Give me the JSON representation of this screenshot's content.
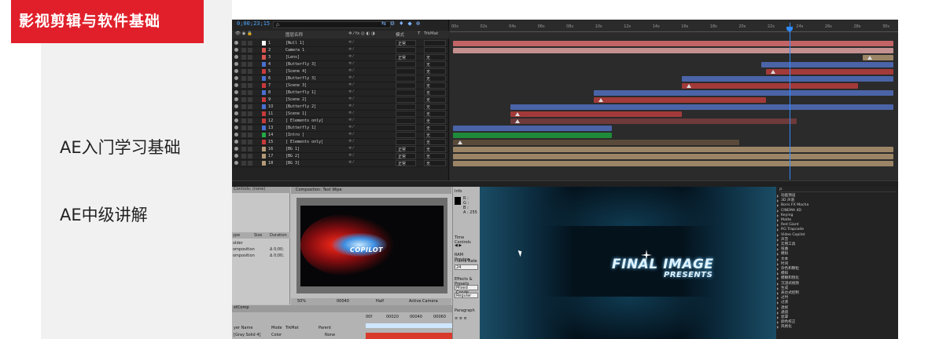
{
  "course": {
    "badge": "影视剪辑与软件基础",
    "lessons": [
      "AE入门学习基础",
      "AE中级讲解"
    ]
  },
  "timeline": {
    "timecode": "0;00;23;15",
    "search_placeholder": "ρ.",
    "columns": {
      "name": "图层名称",
      "mode": "模式",
      "t": "T",
      "trkmat": "TrkMat"
    },
    "layers": [
      {
        "num": "1",
        "name": "[Null 1]",
        "color": "#ffffff",
        "mode": "正常",
        "trk": ""
      },
      {
        "num": "2",
        "name": "Camera 1",
        "color": "#d9534f",
        "mode": "",
        "trk": ""
      },
      {
        "num": "3",
        "name": "[Lens]",
        "color": "#d9534f",
        "mode": "正常",
        "trk": "无"
      },
      {
        "num": "4",
        "name": "[Butterfly 3]",
        "color": "#4a6fd0",
        "mode": "",
        "trk": "无"
      },
      {
        "num": "5",
        "name": "[Scene 4]",
        "color": "#c83a3a",
        "mode": "",
        "trk": "无"
      },
      {
        "num": "6",
        "name": "[Butterfly 3]",
        "color": "#4a6fd0",
        "mode": "",
        "trk": "无"
      },
      {
        "num": "7",
        "name": "[Scene 3]",
        "color": "#c83a3a",
        "mode": "",
        "trk": "无"
      },
      {
        "num": "8",
        "name": "[Butterfly 1]",
        "color": "#4a6fd0",
        "mode": "",
        "trk": "无"
      },
      {
        "num": "9",
        "name": "[Scene 2]",
        "color": "#c83a3a",
        "mode": "",
        "trk": "无"
      },
      {
        "num": "10",
        "name": "[Butterfly 2]",
        "color": "#4a6fd0",
        "mode": "",
        "trk": "无"
      },
      {
        "num": "11",
        "name": "[Scene 1]",
        "color": "#c83a3a",
        "mode": "",
        "trk": "无"
      },
      {
        "num": "12",
        "name": "[ Elements only]",
        "color": "#c83a3a",
        "mode": "",
        "trk": "无"
      },
      {
        "num": "13",
        "name": "[Butterfly 1]",
        "color": "#4a6fd0",
        "mode": "",
        "trk": "无"
      },
      {
        "num": "14",
        "name": "[Intro ]",
        "color": "#22aa44",
        "mode": "",
        "trk": "无"
      },
      {
        "num": "15",
        "name": "[ Elements only]",
        "color": "#c83a3a",
        "mode": "",
        "trk": "无"
      },
      {
        "num": "16",
        "name": "[BG 1]",
        "color": "#b59a78",
        "mode": "正常",
        "trk": "无"
      },
      {
        "num": "17",
        "name": "[BG 2]",
        "color": "#b59a78",
        "mode": "正常",
        "trk": "无"
      },
      {
        "num": "18",
        "name": "[BG 3]",
        "color": "#b59a78",
        "mode": "正常",
        "trk": "无"
      }
    ],
    "ruler_ticks": [
      "00s",
      "02s",
      "04s",
      "06s",
      "08s",
      "10s",
      "12s",
      "14s",
      "16s",
      "18s",
      "20s",
      "22s",
      "24s",
      "26s",
      "28s",
      "30s"
    ],
    "bars": [
      {
        "start": 0.0,
        "end": 1.0,
        "color": "#c26466"
      },
      {
        "start": 0.0,
        "end": 1.0,
        "color": "#c49090"
      },
      {
        "start": 0.93,
        "end": 1.0,
        "color": "#9c8566",
        "key": true
      },
      {
        "start": 0.7,
        "end": 1.0,
        "color": "#4b64a8"
      },
      {
        "start": 0.71,
        "end": 1.0,
        "color": "#a33a3a",
        "key": true
      },
      {
        "start": 0.52,
        "end": 1.0,
        "color": "#4b64a8"
      },
      {
        "start": 0.52,
        "end": 0.92,
        "color": "#a33a3a",
        "key": true
      },
      {
        "start": 0.32,
        "end": 1.0,
        "color": "#4b64a8"
      },
      {
        "start": 0.32,
        "end": 0.71,
        "color": "#a33a3a",
        "key": true
      },
      {
        "start": 0.13,
        "end": 1.0,
        "color": "#4b64a8"
      },
      {
        "start": 0.13,
        "end": 0.52,
        "color": "#a33a3a",
        "key": true
      },
      {
        "start": 0.13,
        "end": 0.78,
        "color": "#6e3a3a",
        "key": true
      },
      {
        "start": 0.0,
        "end": 0.36,
        "color": "#4b64a8"
      },
      {
        "start": 0.0,
        "end": 0.36,
        "color": "#1f8a3a"
      },
      {
        "start": 0.0,
        "end": 0.65,
        "color": "#5a4a3a",
        "key": true
      },
      {
        "start": 0.0,
        "end": 1.0,
        "color": "#9c8566"
      },
      {
        "start": 0.0,
        "end": 1.0,
        "color": "#9c8566"
      },
      {
        "start": 0.0,
        "end": 1.0,
        "color": "#9c8566"
      }
    ]
  },
  "comp_panel": {
    "controls_tab": "Controls: (none)",
    "comp_tab": "Composition: Text Wipe",
    "project_cols": {
      "type": "ype",
      "size": "Size",
      "duration": "Duration"
    },
    "project_items": [
      {
        "type": "older",
        "size": "",
        "duration": ""
      },
      {
        "type": "omposition",
        "size": "",
        "duration": "Δ 0;00;"
      },
      {
        "type": "omposition",
        "size": "",
        "duration": "Δ 0;00;"
      }
    ],
    "comp_text": "COPILOT",
    "footer": {
      "zoom": "50%",
      "frame": "00040",
      "quality": "Half",
      "camera": "Active Camera"
    },
    "info": {
      "title": "Info",
      "r": "R :",
      "g": "G :",
      "b": "B :",
      "a": "A : 255",
      "time_controls": "Time Controls",
      "ram_preview": "RAM Preview",
      "frame_rate": "Frame Rate",
      "frame_rate_val": "24",
      "effects_presets": "Effects & Presets",
      "search_val": "Mixed Conde",
      "regular": "Regular",
      "paragraph": "Paragraph"
    },
    "timeline": {
      "tab": "xtComp",
      "layer_name": "yer Name",
      "mode": "Mode",
      "trkmat": "TrkMat",
      "parent": "Parent",
      "row_name": "[Gray Solid 4]",
      "row_mode": "Color",
      "row_parent": "None",
      "ticks": [
        "00f",
        "00020",
        "00040",
        "00060"
      ]
    }
  },
  "final_frame": {
    "title": "FINAL IMAGE",
    "subtitle": "PRESENTS"
  },
  "effects": {
    "search": "ρ.",
    "items": [
      "动画预设",
      "3D 声道",
      "Boris FX Mocha",
      "CINEMA 4D",
      "Keying",
      "Matte",
      "Red Giant",
      "RG Trapcode",
      "Video Copilot",
      "声音",
      "实用工具",
      "扭曲",
      "模拟",
      "文本",
      "时间",
      "杂色和颗粒",
      "模拟",
      "模糊和锐化",
      "沉浸式视频",
      "生成",
      "表达式控制",
      "过时",
      "过渡",
      "透视",
      "通道",
      "遮罩",
      "颜色校正",
      "风格化"
    ]
  }
}
